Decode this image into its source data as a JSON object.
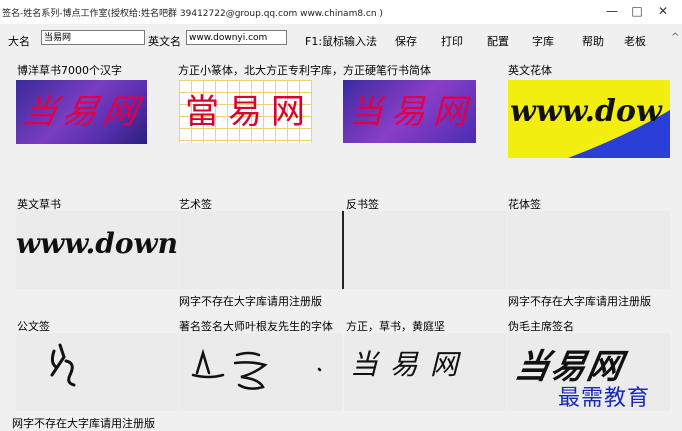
{
  "window": {
    "title": "签名-姓名系列-博点工作室(授权给:姓名吧群 39412722@group.qq.com www.chinam8.cn )",
    "minimize_glyph": "—",
    "maximize_glyph": "□",
    "close_glyph": "✕"
  },
  "toolbar": {
    "name_label": "大名",
    "name_value": "当易网",
    "en_label": "英文名",
    "en_value": "www.downyi.com",
    "menu": [
      "F1:鼠标输入法",
      "保存",
      "打印",
      "配置",
      "字库",
      "帮助",
      "老板"
    ],
    "scroll_glyph": "^"
  },
  "panels": {
    "row1": [
      "博洋草书7000个汉字",
      "方正小篆体，北大方正专利字库，方正硬笔行书简体",
      "英文花体"
    ],
    "row2": [
      "英文草书",
      "艺术签",
      "反书签",
      "花体签"
    ],
    "row2_notes": [
      "网字不存在大字库请用注册版",
      "网字不存在大字库请用注册版"
    ],
    "row3": [
      "公文签",
      "著名签名大师叶根友先生的字体",
      "方正，草书，黄庭坚",
      "伪毛主席签名"
    ],
    "row3_note": "网字不存在大字库请用注册版"
  },
  "samples": {
    "cursive_cn": "当易网",
    "seal_cn": "當易网",
    "pen_cn": "当易网",
    "en_fancy": "www.dow",
    "en_cursive": "www.down",
    "handwritten_cn": "当易网",
    "mao_cn": "当易网"
  },
  "watermark": "最需教育",
  "colors": {
    "magenta_red": "#e0004a",
    "purple_bg": "#6a2db8",
    "yellow_bg": "#f2ee10",
    "blue_corner": "#2a3fd8"
  }
}
